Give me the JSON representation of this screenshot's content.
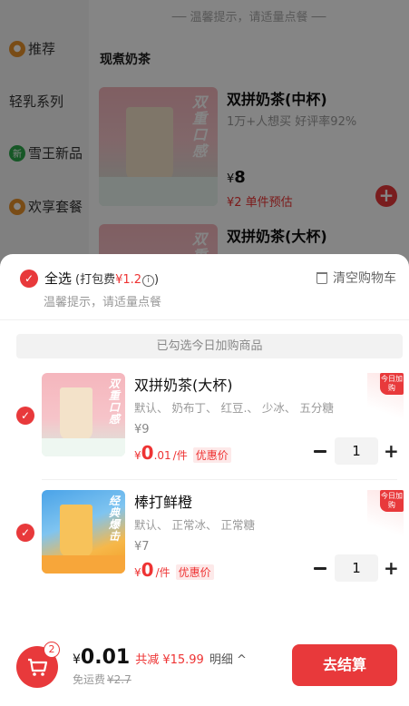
{
  "background": {
    "top_tip": "── 温馨提示，请适量点餐 ──",
    "sidebar": [
      {
        "label": "推荐",
        "icon": "recommend-icon",
        "color": "#e8922b"
      },
      {
        "label": "轻乳系列",
        "icon": "",
        "color": ""
      },
      {
        "label": "雪王新品",
        "icon": "new-icon",
        "color": "#2ba84a"
      },
      {
        "label": "欢享套餐",
        "icon": "combo-icon",
        "color": "#e8922b"
      }
    ],
    "section_title": "现煮奶茶",
    "products": [
      {
        "name": "双拼奶茶(中杯)",
        "sub": "1万+人想买 好评率92%",
        "price": "8",
        "estimate": "¥2 单件预估",
        "image_text": "双重口感"
      },
      {
        "name": "双拼奶茶(大杯)",
        "image_text": "双重口感"
      }
    ]
  },
  "cart": {
    "select_all_label": "全选",
    "pack_prefix": "(打包费",
    "pack_fee": "¥1.2",
    "pack_info": "i",
    "pack_suffix": ")",
    "clear_label": "清空购物车",
    "tip": "温馨提示，请适量点餐",
    "banner": "已勾选今日加购商品",
    "items": [
      {
        "name": "双拼奶茶(大杯)",
        "spec": "默认、 奶布丁、 红豆.、 少冰、 五分糖",
        "original_price": "¥9",
        "price_symbol": "¥",
        "price": "0",
        "price_decimal": ".01",
        "unit": "/件",
        "deal": "优惠价",
        "quantity": "1",
        "image_text": "双重口感",
        "tag": "今日加购"
      },
      {
        "name": "棒打鲜橙",
        "spec": "默认、 正常冰、 正常糖",
        "original_price": "¥7",
        "price_symbol": "¥",
        "price": "0",
        "price_decimal": "",
        "unit": "/件",
        "deal": "优惠价",
        "quantity": "1",
        "image_text": "经典爆击",
        "tag": "今日加购"
      }
    ]
  },
  "footer": {
    "cart_count": "2",
    "total_symbol": "¥",
    "total": "0.01",
    "savings": "共减 ¥15.99",
    "detail": "明细 ^",
    "ship_label": "免运费",
    "ship_original": "¥2.7",
    "checkout_label": "去结算"
  },
  "colors": {
    "accent": "#e8393b",
    "overlay": "rgba(0,0,0,0.48)"
  }
}
